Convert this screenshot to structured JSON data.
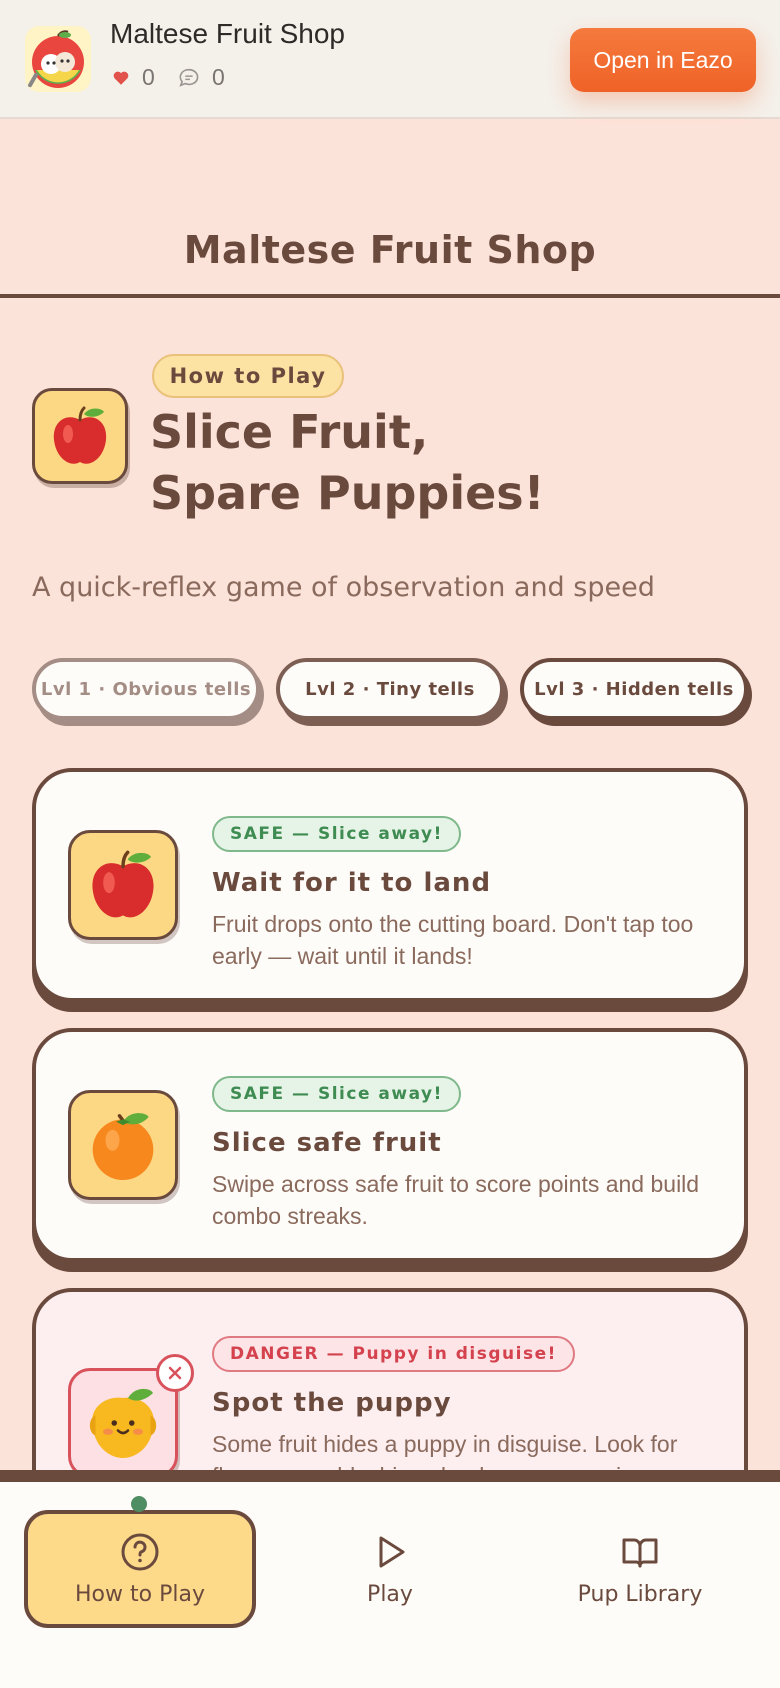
{
  "topbar": {
    "app_title": "Maltese Fruit Shop",
    "likes": "0",
    "comments": "0",
    "open_label": "Open in Eazo",
    "accent": "#ef6227"
  },
  "page": {
    "title": "Maltese Fruit Shop"
  },
  "hero": {
    "badge": "How to Play",
    "title_line1": "Slice Fruit,",
    "title_line2": "Spare Puppies!",
    "subtitle": "A quick-reflex game of observation and speed"
  },
  "levels": [
    {
      "label": "Lvl 1 · Obvious tells"
    },
    {
      "label": "Lvl 2 · Tiny tells"
    },
    {
      "label": "Lvl 3 · Hidden tells"
    }
  ],
  "cards": [
    {
      "tag": "SAFE — Slice away!",
      "title": "Wait for it to land",
      "body": "Fruit drops onto the cutting board. Don't tap too early — wait until it lands!",
      "icon": "apple-icon"
    },
    {
      "tag": "SAFE — Slice away!",
      "title": "Slice safe fruit",
      "body": "Swipe across safe fruit to score points and build combo streaks.",
      "icon": "orange-icon"
    },
    {
      "tag": "DANGER — Puppy in disguise!",
      "title": "Spot the puppy",
      "body": "Some fruit hides a puppy in disguise. Look for floppy ears, blushing cheeks, or a wagging",
      "icon": "puppy-orange-icon"
    }
  ],
  "nav": {
    "items": [
      {
        "label": "How to Play",
        "icon": "question-circle-icon",
        "active": true
      },
      {
        "label": "Play",
        "icon": "play-icon"
      },
      {
        "label": "Pup Library",
        "icon": "book-icon"
      }
    ]
  },
  "colors": {
    "background": "#fce3d9",
    "ink": "#6b4a3e",
    "safe": "#3f8c52",
    "danger": "#d4424e",
    "active_tab": "#fdd98a"
  }
}
